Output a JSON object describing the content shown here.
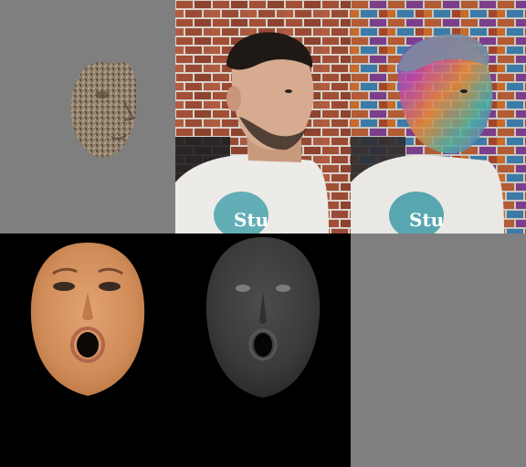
{
  "panels": [
    {
      "id": "textured-face-render"
    },
    {
      "id": "input-photo",
      "shirt_print": "Stu"
    },
    {
      "id": "overlay-photo",
      "shirt_print": "Stu"
    },
    {
      "id": "uv-albedo-map"
    },
    {
      "id": "uv-shading-map"
    },
    {
      "id": "empty-panel"
    }
  ],
  "colors": {
    "background_gray": "#808080",
    "brick": "#9a4a34",
    "mortar": "#d8d2c8",
    "skin": "#d08c58",
    "shading_gray": "#3a3c3a"
  }
}
